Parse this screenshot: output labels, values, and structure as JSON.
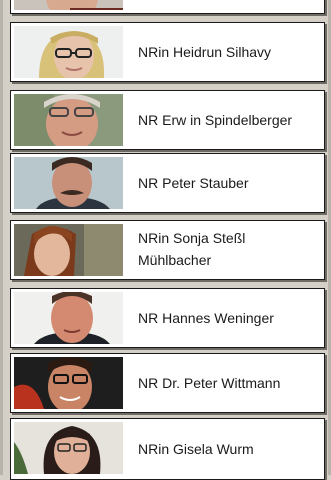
{
  "people": [
    {
      "name": "",
      "icon": "portrait-photo"
    },
    {
      "name": "NRin Heidrun Silhavy",
      "icon": "portrait-photo"
    },
    {
      "name": "NR Erw in Spindelberger",
      "icon": "portrait-photo"
    },
    {
      "name": "NR Peter Stauber",
      "icon": "portrait-photo"
    },
    {
      "name": "NRin Sonja Steßl Mühlbacher",
      "icon": "portrait-photo"
    },
    {
      "name": "NR Hannes Weninger",
      "icon": "portrait-photo"
    },
    {
      "name": "NR Dr. Peter Wittmann",
      "icon": "portrait-photo"
    },
    {
      "name": "NRin Gisela Wurm",
      "icon": "portrait-photo"
    }
  ],
  "colors": {
    "background": "#d4d0c8",
    "card": "#ffffff",
    "border": "#1a1a1a",
    "text": "#1a1a1a"
  }
}
